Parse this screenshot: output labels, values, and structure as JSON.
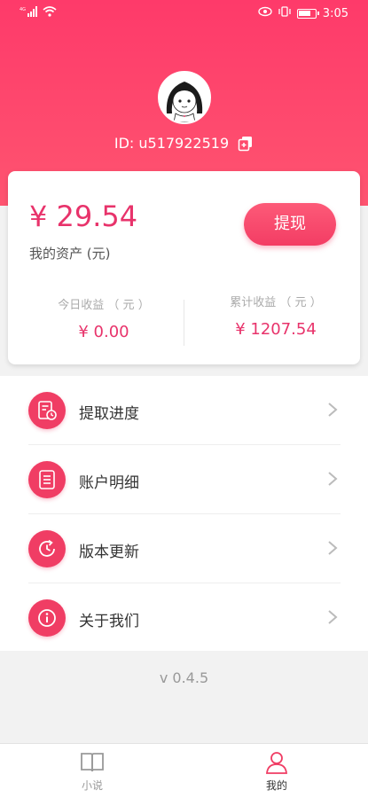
{
  "status_bar": {
    "time": "3:05",
    "signal_label": "4G"
  },
  "profile": {
    "user_id_label": "ID: u517922519"
  },
  "wallet": {
    "balance": "¥ 29.54",
    "balance_label": "我的资产 (元)",
    "withdraw_label": "提现",
    "today_label": "今日收益 （ 元 ）",
    "today_value": "¥ 0.00",
    "total_label": "累计收益 （ 元 ）",
    "total_value": "¥ 1207.54"
  },
  "menu": {
    "items": [
      {
        "label": "提取进度",
        "icon": "progress-icon"
      },
      {
        "label": "账户明细",
        "icon": "document-icon"
      },
      {
        "label": "版本更新",
        "icon": "update-icon"
      },
      {
        "label": "关于我们",
        "icon": "info-icon"
      }
    ]
  },
  "version": "v 0.4.5",
  "tabs": [
    {
      "label": "小说",
      "icon": "book-icon",
      "active": false
    },
    {
      "label": "我的",
      "icon": "user-icon",
      "active": true
    }
  ],
  "colors": {
    "brand": "#f03d64",
    "accent_text": "#e8336b"
  }
}
